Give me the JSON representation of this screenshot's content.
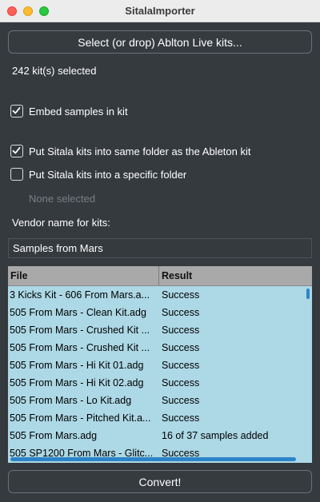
{
  "window": {
    "title": "SitalaImporter"
  },
  "select_button": {
    "label": "Select (or drop) Ablton Live kits..."
  },
  "selection_status": "242 kit(s) selected",
  "options": {
    "embed_samples": {
      "label": "Embed samples in kit",
      "checked": true
    },
    "same_folder": {
      "label": "Put Sitala kits into same folder as the Ableton kit",
      "checked": true
    },
    "specific_folder": {
      "label": "Put Sitala kits into a specific folder",
      "checked": false
    },
    "folder_status": "None selected"
  },
  "vendor": {
    "label": "Vendor name for kits:",
    "value": "Samples from Mars"
  },
  "table": {
    "columns": [
      "File",
      "Result"
    ],
    "rows": [
      {
        "file": "3 Kicks Kit - 606 From Mars.a...",
        "result": "Success"
      },
      {
        "file": "505 From Mars - Clean Kit.adg",
        "result": "Success"
      },
      {
        "file": "505 From Mars - Crushed Kit ...",
        "result": "Success"
      },
      {
        "file": "505 From Mars - Crushed Kit ...",
        "result": "Success"
      },
      {
        "file": "505 From Mars - Hi Kit 01.adg",
        "result": "Success"
      },
      {
        "file": "505 From Mars - Hi Kit 02.adg",
        "result": "Success"
      },
      {
        "file": "505 From Mars - Lo Kit.adg",
        "result": "Success"
      },
      {
        "file": "505 From Mars - Pitched Kit.a...",
        "result": "Success"
      },
      {
        "file": "505 From Mars.adg",
        "result": "16 of 37 samples added"
      },
      {
        "file": "505 SP1200 From Mars - Glitc...",
        "result": "Success"
      }
    ]
  },
  "convert_button": {
    "label": "Convert!"
  },
  "colors": {
    "window_bg": "#353a3f",
    "table_bg": "#add8e6",
    "table_header_bg": "#a9a9a9",
    "scrollbar": "#2c84c7"
  }
}
